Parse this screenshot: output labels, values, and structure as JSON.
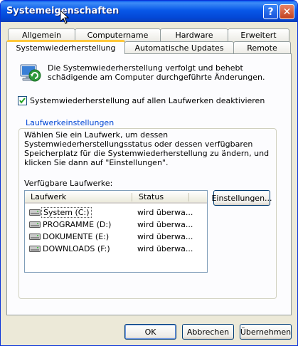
{
  "window": {
    "title": "Systemeigenschaften",
    "help_glyph": "?",
    "close_glyph": "✕"
  },
  "tabs": {
    "row_back": [
      "Allgemein",
      "Computername",
      "Hardware",
      "Erweitert"
    ],
    "row_front": [
      "Systemwiederherstellung",
      "Automatische Updates",
      "Remote"
    ],
    "active": "Systemwiederherstellung"
  },
  "panel": {
    "intro_text": "Die Systemwiederherstellung verfolgt und behebt schädigende am Computer durchgeführte Änderungen.",
    "disable_checkbox": {
      "label": "Systemwiederherstellung auf allen Laufwerken deaktivieren",
      "checked": true
    },
    "drive_settings": {
      "legend": "Laufwerkeinstellungen",
      "description": "Wählen Sie ein Laufwerk, um dessen Systemwiederherstellungsstatus oder dessen verfügbaren Speicherplatz für die Systemwiederherstellung zu ändern, und klicken Sie dann auf \"Einstellungen\".",
      "available_label": "Verfügbare Laufwerke:",
      "columns": [
        "Laufwerk",
        "Status"
      ],
      "drives": [
        {
          "name": "System (C:)",
          "status": "wird überwa..."
        },
        {
          "name": "PROGRAMME (D:)",
          "status": "wird überwa..."
        },
        {
          "name": "DOKUMENTE (E:)",
          "status": "wird überwa..."
        },
        {
          "name": "DOWNLOADS (F:)",
          "status": "wird überwa..."
        }
      ],
      "settings_button": "Einstellungen..."
    }
  },
  "buttons": {
    "ok": "OK",
    "cancel": "Abbrechen",
    "apply": "Übernehmen"
  },
  "colors": {
    "titlebar": "#0858e8",
    "tab_highlight": "#ffc83c",
    "legend_text": "#0046d5"
  }
}
